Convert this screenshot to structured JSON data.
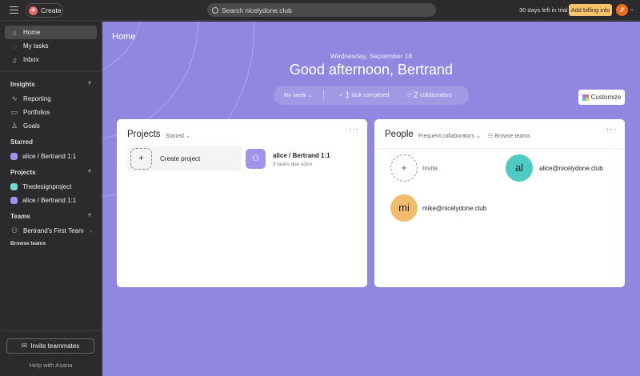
{
  "topbar": {
    "create": "Create",
    "search_placeholder": "Search nicelydone.club",
    "trial": "30 days left in trial",
    "billing": "Add billing info",
    "avatar_initial": "//"
  },
  "sidebar": {
    "nav": [
      {
        "label": "Home",
        "icon": "home-icon"
      },
      {
        "label": "My tasks",
        "icon": "check-circle-icon"
      },
      {
        "label": "Inbox",
        "icon": "bell-icon"
      }
    ],
    "insights_title": "Insights",
    "insights": [
      "Reporting",
      "Portfolios",
      "Goals"
    ],
    "starred_title": "Starred",
    "starred": [
      {
        "label": "alice / Bertrand 1:1",
        "color": "#9f94ea"
      }
    ],
    "projects_title": "Projects",
    "projects": [
      {
        "label": "Thedesignproject",
        "color": "#6fd9d1"
      },
      {
        "label": "alice / Bertrand 1:1",
        "color": "#9f94ea"
      }
    ],
    "teams_title": "Teams",
    "team": "Bertrand's First Team",
    "browse": "Browse teams",
    "invite": "Invite teammates",
    "help": "Help with Asana"
  },
  "main": {
    "title": "Home",
    "date": "Wednesday, September 18",
    "greeting": "Good afternoon, Bertrand",
    "period": "My week",
    "tasks_count": "1",
    "tasks_label": "task completed",
    "collab_count": "2",
    "collab_label": "collaborators",
    "customize": "Customize"
  },
  "projects_card": {
    "title": "Projects",
    "filter": "Starred",
    "create": "Create project",
    "project": {
      "name": "alice / Bertrand 1:1",
      "sub": "3 tasks due soon"
    }
  },
  "people_card": {
    "title": "People",
    "filter": "Frequent collaborators",
    "browse": "Browse teams",
    "invite": "Invite",
    "people": [
      {
        "initials": "al",
        "email": "alice@nicelydone.club",
        "color": "#4ecbc4"
      },
      {
        "initials": "mi",
        "email": "mike@nicelydone.club",
        "color": "#f1bd6c"
      }
    ]
  }
}
